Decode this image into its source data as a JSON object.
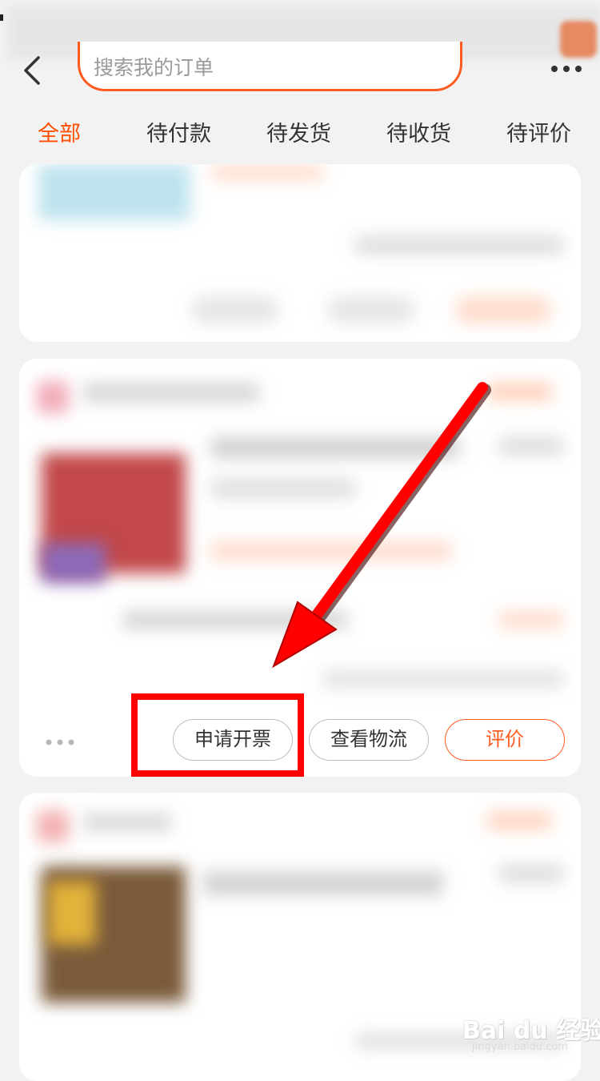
{
  "header": {
    "search_placeholder": "搜索我的订单"
  },
  "tabs": [
    {
      "label": "全部",
      "active": true
    },
    {
      "label": "待付款",
      "active": false
    },
    {
      "label": "待发货",
      "active": false
    },
    {
      "label": "待收货",
      "active": false
    },
    {
      "label": "待评价",
      "active": false
    }
  ],
  "order_card": {
    "buttons": {
      "invoice": "申请开票",
      "logistics": "查看物流",
      "review": "评价"
    }
  },
  "watermark": {
    "logo": "Bai du 经验",
    "url": "jingyan.baidu.com"
  },
  "colors": {
    "accent": "#ff5a1f",
    "annotation": "#ff0000",
    "background": "#f2f2f2"
  }
}
